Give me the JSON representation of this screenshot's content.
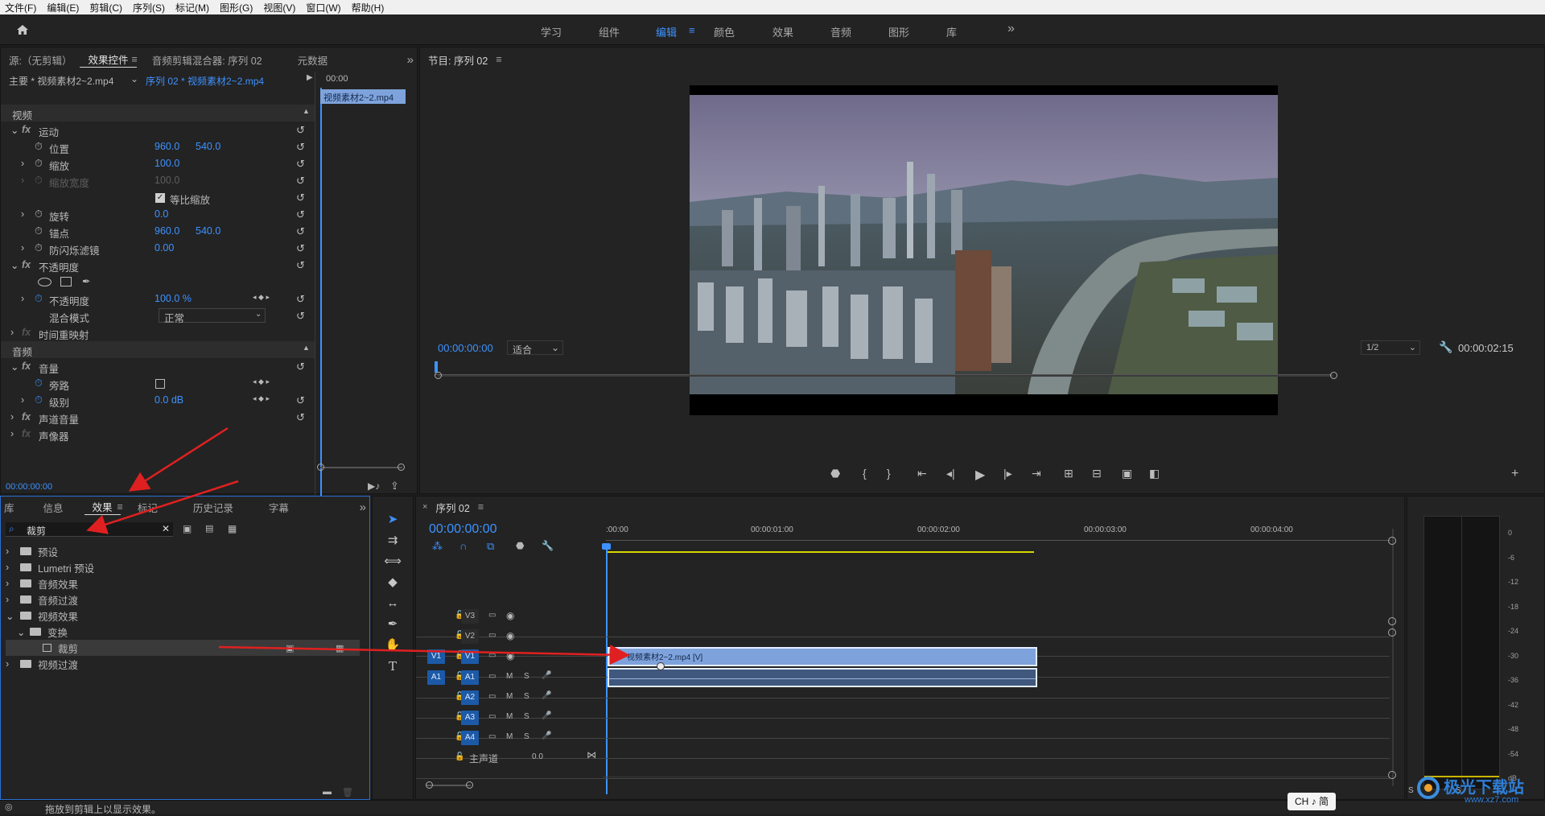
{
  "menu": [
    "文件(F)",
    "编辑(E)",
    "剪辑(C)",
    "序列(S)",
    "标记(M)",
    "图形(G)",
    "视图(V)",
    "窗口(W)",
    "帮助(H)"
  ],
  "workspaces": {
    "items": [
      "学习",
      "组件",
      "编辑",
      "颜色",
      "效果",
      "音频",
      "图形",
      "库"
    ],
    "active": "编辑",
    "more": "»"
  },
  "source_panel": {
    "tabs": [
      "源:（无剪辑）",
      "效果控件",
      "音频剪辑混合器: 序列 02",
      "元数据"
    ],
    "master": "主要 * 视频素材2~2.mp4",
    "sequence_clip": "序列 02 * 视频素材2~2.mp4",
    "mini_time": "00:00",
    "mini_clip": "视频素材2~2.mp4",
    "video_header": "视频",
    "audio_header": "音频",
    "fx_motion": "运动",
    "position_label": "位置",
    "position_x": "960.0",
    "position_y": "540.0",
    "scale_label": "缩放",
    "scale_value": "100.0",
    "scale_width_label": "缩放宽度",
    "scale_width_value": "100.0",
    "uniform_scale": "等比缩放",
    "rotation_label": "旋转",
    "rotation_value": "0.0",
    "anchor_label": "锚点",
    "anchor_x": "960.0",
    "anchor_y": "540.0",
    "antiflicker_label": "防闪烁滤镜",
    "antiflicker_value": "0.00",
    "fx_opacity": "不透明度",
    "opacity_label": "不透明度",
    "opacity_value": "100.0 %",
    "blend_label": "混合模式",
    "blend_value": "正常",
    "time_remap": "时间重映射",
    "fx_volume": "音量",
    "bypass_label": "旁路",
    "level_label": "级别",
    "level_value": "0.0 dB",
    "channel_volume": "声道音量",
    "panner": "声像器",
    "timecode": "00:00:00:00"
  },
  "program_monitor": {
    "title": "节目: 序列 02",
    "timecode": "00:00:00:00",
    "fit": "适合",
    "resolution": "1/2",
    "duration": "00:00:02:15"
  },
  "effects_panel": {
    "tabs": [
      "库",
      "信息",
      "效果",
      "标记",
      "历史记录",
      "字幕"
    ],
    "search_value": "裁剪",
    "tree": [
      {
        "label": "预设",
        "level": 0,
        "expanded": false
      },
      {
        "label": "Lumetri 预设",
        "level": 0,
        "expanded": false
      },
      {
        "label": "音频效果",
        "level": 0,
        "expanded": false
      },
      {
        "label": "音频过渡",
        "level": 0,
        "expanded": false
      },
      {
        "label": "视频效果",
        "level": 0,
        "expanded": true
      },
      {
        "label": "变换",
        "level": 1,
        "expanded": true
      },
      {
        "label": "裁剪",
        "level": 2,
        "selected": true
      },
      {
        "label": "视频过渡",
        "level": 0,
        "expanded": false
      }
    ]
  },
  "timeline": {
    "title": "序列 02",
    "timecode": "00:00:00:00",
    "ruler": [
      ":00:00",
      "00:00:01:00",
      "00:00:02:00",
      "00:00:03:00",
      "00:00:04:00"
    ],
    "video_tracks": [
      "V3",
      "V2",
      "V1"
    ],
    "audio_tracks": [
      "A1",
      "A2",
      "A3",
      "A4"
    ],
    "source_v": "V1",
    "source_a": "A1",
    "master_label": "主声道",
    "master_value": "0.0",
    "clip_label": "视频素材2~2.mp4 [V]",
    "mute": "M",
    "solo": "S"
  },
  "meter": {
    "scale": [
      "0",
      "-6",
      "-12",
      "-18",
      "-24",
      "-30",
      "-36",
      "-42",
      "-48",
      "-54",
      "dB"
    ],
    "bottom": [
      "S",
      "S"
    ]
  },
  "status": {
    "text": "拖放到剪辑上以显示效果。",
    "ime": "CH ♪ 简"
  },
  "watermark": {
    "main": "极光下载站",
    "sub": "www.xz7.com"
  },
  "colors": {
    "accent": "#3d92ff",
    "clip_video": "#7ea3dc",
    "clip_audio": "#40587d",
    "playhead": "#3d92ff",
    "annotation": "#e02020",
    "workarea": "#d8d800"
  }
}
